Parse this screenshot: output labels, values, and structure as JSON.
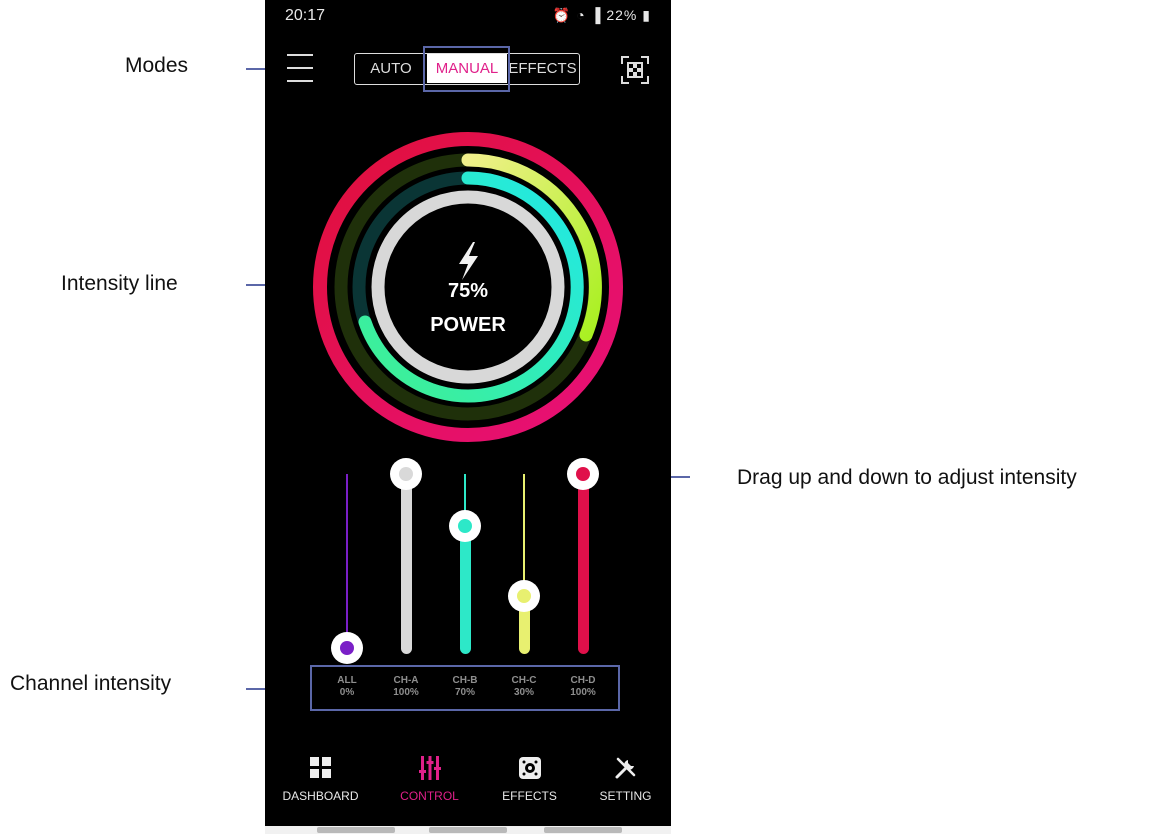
{
  "callouts": {
    "modes": "Modes",
    "intensity_line": "Intensity line",
    "drag": "Drag up and down to adjust intensity",
    "channel_intensity": "Channel intensity"
  },
  "status_bar": {
    "time": "20:17",
    "battery": "22%",
    "icons": [
      "alarm-icon",
      "wifi-icon",
      "signal-icon",
      "battery-icon"
    ]
  },
  "header": {
    "modes": [
      {
        "label": "AUTO",
        "active": false
      },
      {
        "label": "MANUAL",
        "active": true
      },
      {
        "label": "EFFECTS",
        "active": false
      }
    ],
    "menu_icon": "hamburger-menu-icon",
    "qr_icon": "qr-scan-icon"
  },
  "gauge": {
    "value": "75%",
    "label": "POWER",
    "icon": "lightning-icon",
    "rings": [
      {
        "level": 1.0,
        "color": "#e0103c"
      },
      {
        "level": 0.3,
        "color": "#eef07a"
      },
      {
        "level": 0.7,
        "color": "#2de0c8"
      },
      {
        "level": 1.0,
        "color": "#d8d8d8"
      }
    ]
  },
  "channels": [
    {
      "name": "ALL",
      "value": "0%",
      "level": 0.0,
      "color": "#7a1fc7"
    },
    {
      "name": "CH-A",
      "value": "100%",
      "level": 1.0,
      "color": "#d9d9d9"
    },
    {
      "name": "CH-B",
      "value": "70%",
      "level": 0.7,
      "color": "#2de8c8"
    },
    {
      "name": "CH-C",
      "value": "30%",
      "level": 0.3,
      "color": "#e8f070"
    },
    {
      "name": "CH-D",
      "value": "100%",
      "level": 1.0,
      "color": "#e0104a"
    }
  ],
  "nav": [
    {
      "label": "DASHBOARD",
      "icon": "dashboard-grid-icon",
      "active": false
    },
    {
      "label": "CONTROL",
      "icon": "sliders-icon",
      "active": true
    },
    {
      "label": "EFFECTS",
      "icon": "effects-icon",
      "active": false
    },
    {
      "label": "SETTING",
      "icon": "tools-icon",
      "active": false
    }
  ],
  "colors": {
    "accent": "#e0208a",
    "callout": "#5b67a8",
    "screen_bg": "#000000"
  }
}
